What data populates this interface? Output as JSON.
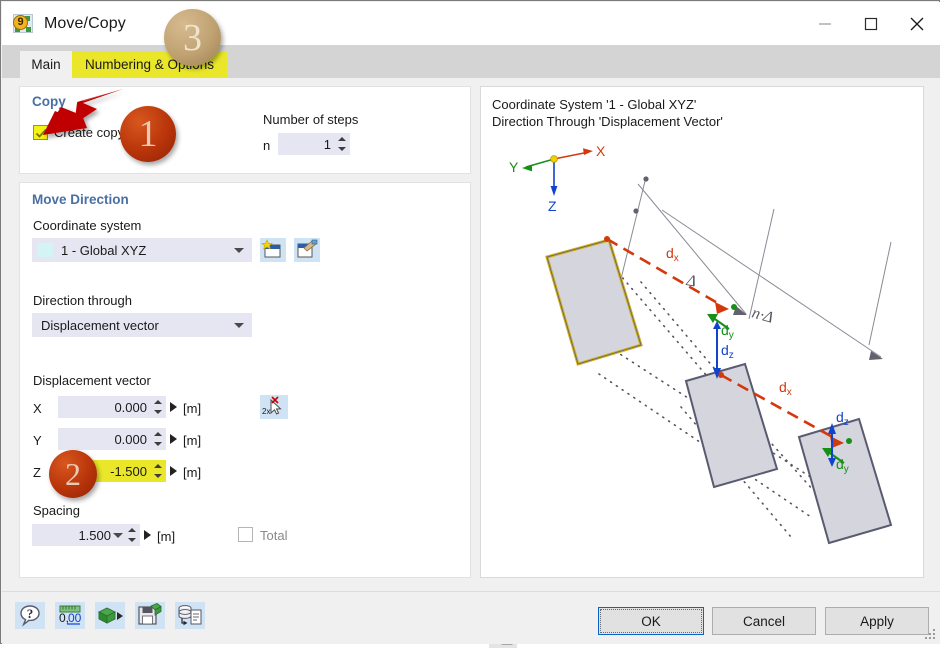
{
  "window": {
    "title": "Move/Copy",
    "app_icon": "rfem-app-icon",
    "controls": {
      "minimize": "minimize-icon",
      "maximize": "maximize-icon",
      "close": "close-icon"
    }
  },
  "tabs": [
    {
      "label": "Main",
      "state": "active"
    },
    {
      "label": "Numbering & Options",
      "state": "highlighted"
    }
  ],
  "copy_group": {
    "title": "Copy",
    "create_copy_label": "Create copy",
    "create_copy_checked": true,
    "number_of_steps_label": "Number of steps",
    "n_label": "n",
    "n_value": "1"
  },
  "move_direction": {
    "title": "Move Direction",
    "coordinate_system_label": "Coordinate system",
    "coordinate_system_value": "1 - Global XYZ",
    "new_cs_icon": "new-coordinate-system-icon",
    "edit_cs_icon": "edit-coordinate-system-icon",
    "direction_through_label": "Direction through",
    "direction_through_value": "Displacement vector",
    "displacement_vector_label": "Displacement vector",
    "pick_icon": "pick-two-points-icon",
    "rows": [
      {
        "axis": "X",
        "value": "0.000",
        "unit": "[m]",
        "highlighted": false
      },
      {
        "axis": "Y",
        "value": "0.000",
        "unit": "[m]",
        "highlighted": false
      },
      {
        "axis": "Z",
        "value": "-1.500",
        "unit": "[m]",
        "highlighted": true
      }
    ],
    "spacing_label": "Spacing",
    "spacing_value": "1.500",
    "spacing_unit": "[m]",
    "total_label": "Total",
    "total_checked": false
  },
  "preview": {
    "line1": "Coordinate System '1 - Global XYZ'",
    "line2": "Direction Through 'Displacement Vector'",
    "axes": {
      "x": "X",
      "y": "Y",
      "z": "Z"
    },
    "dim_delta": "Δ",
    "dim_n_delta": "n·Δ",
    "labels": {
      "dx": "d",
      "dx_sub": "x",
      "dy": "d",
      "dy_sub": "y",
      "dz": "d",
      "dz_sub": "z"
    },
    "view_icon": "view-toggle-icon"
  },
  "toolbar": [
    {
      "name": "help-icon"
    },
    {
      "name": "units-decimal-places-icon"
    },
    {
      "name": "export-icon"
    },
    {
      "name": "save-icon"
    },
    {
      "name": "database-report-icon"
    }
  ],
  "buttons": {
    "ok": "OK",
    "cancel": "Cancel",
    "apply": "Apply"
  },
  "annotations": [
    {
      "id": "1",
      "kind": "orange"
    },
    {
      "id": "2",
      "kind": "orange"
    },
    {
      "id": "3",
      "kind": "tan"
    }
  ],
  "colors": {
    "highlight_yellow": "#eae72a",
    "field_bg": "#e5e6f2",
    "group_title": "#4a6fa5",
    "arrow_red": "#c00000",
    "axis_x": "#d4380d",
    "axis_y": "#169016",
    "axis_z": "#1143cf",
    "dim_gray": "#7a7a8a",
    "object_outline": "#5a5a70",
    "object_fill": "#d5d5dd",
    "selected_outline": "#d4b219"
  }
}
